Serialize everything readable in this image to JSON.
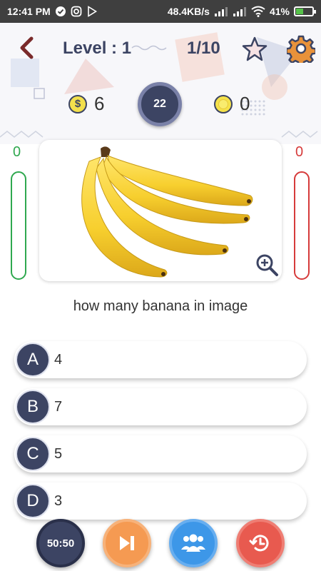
{
  "status_bar": {
    "time": "12:41 PM",
    "network_speed": "48.4KB/s",
    "battery": "41%"
  },
  "top_bar": {
    "level_label": "Level : 1",
    "progress": "1/10"
  },
  "stats": {
    "money": "6",
    "timer": "22",
    "coins": "0"
  },
  "scores": {
    "correct": "0",
    "wrong": "0"
  },
  "question": {
    "text": "how many banana in image",
    "image": "banana-bunch-image"
  },
  "answers": [
    {
      "letter": "A",
      "text": "4"
    },
    {
      "letter": "B",
      "text": "7"
    },
    {
      "letter": "C",
      "text": "5"
    },
    {
      "letter": "D",
      "text": "3"
    }
  ],
  "lifelines": {
    "fifty_fifty_label": "50:50",
    "skip_icon": "skip-icon",
    "audience_icon": "people-icon",
    "time_icon": "clock-rewind-icon"
  },
  "colors": {
    "primary": "#3c4463",
    "correct": "#2fa84f",
    "wrong": "#d63b3b",
    "skip": "#f59a52",
    "audience": "#3d97e8",
    "time": "#e85a4f"
  }
}
